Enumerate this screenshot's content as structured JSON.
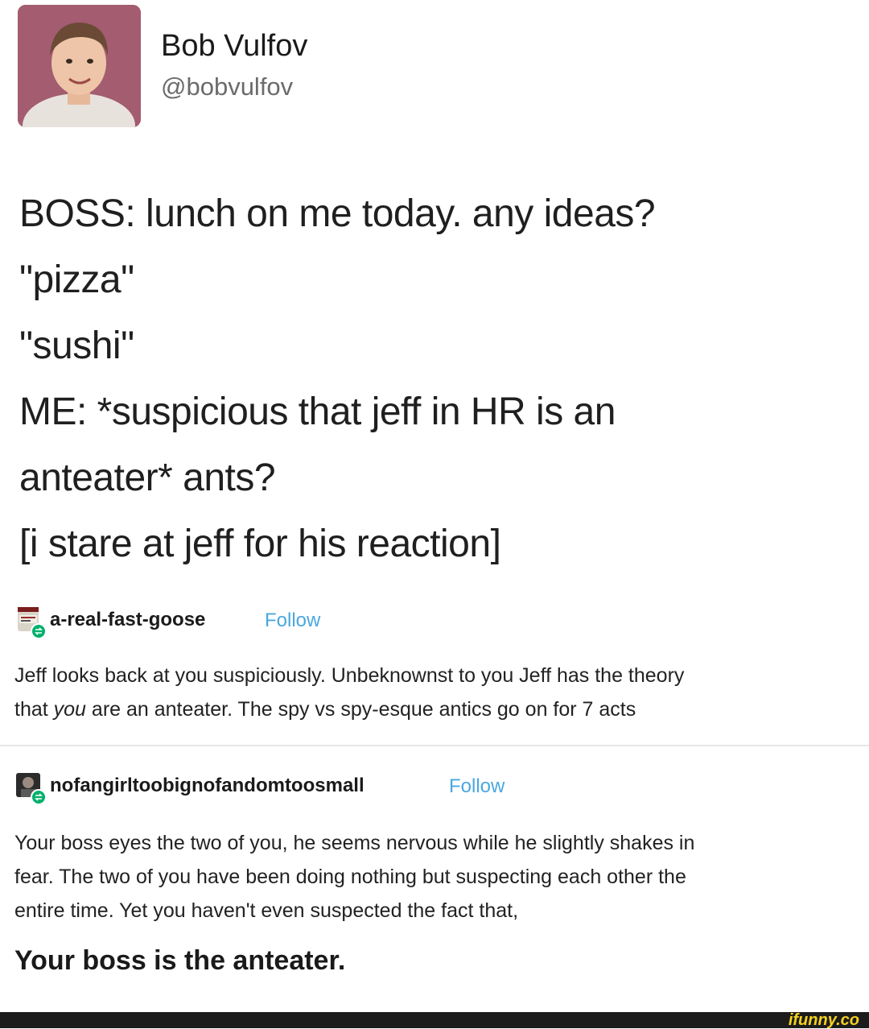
{
  "tweet": {
    "author_name": "Bob Vulfov",
    "author_handle": "@bobvulfov",
    "lines": [
      "BOSS: lunch on me today. any ideas?",
      "\"pizza\"",
      "\"sushi\"",
      "ME: *suspicious that jeff in HR is an",
      "anteater* ants?",
      "[i stare at jeff for his reaction]"
    ]
  },
  "reblog_1": {
    "username": "a-real-fast-goose",
    "follow_label": "Follow",
    "line1": "Jeff looks back at you suspiciously. Unbeknownst to you Jeff has the theory",
    "line2_pre": "that ",
    "line2_em": "you",
    "line2_post": " are an anteater. The spy vs spy-esque antics go on for 7 acts"
  },
  "reblog_2": {
    "username": "nofangirltoobignofandomtoosmall",
    "follow_label": "Follow",
    "lines": [
      "Your boss eyes the two of you, he seems nervous while he slightly shakes in",
      "fear. The two of you have been doing nothing but suspecting each other the",
      "entire time. Yet you haven't even suspected the fact that,"
    ],
    "final_line": "Your boss is the anteater."
  },
  "watermark": "ifunny.co",
  "colors": {
    "follow": "#4aa8e0",
    "reblog_badge": "#00b06b",
    "watermark": "#f5d21f"
  },
  "icons": {
    "reblog_badge": "reblog-icon"
  }
}
